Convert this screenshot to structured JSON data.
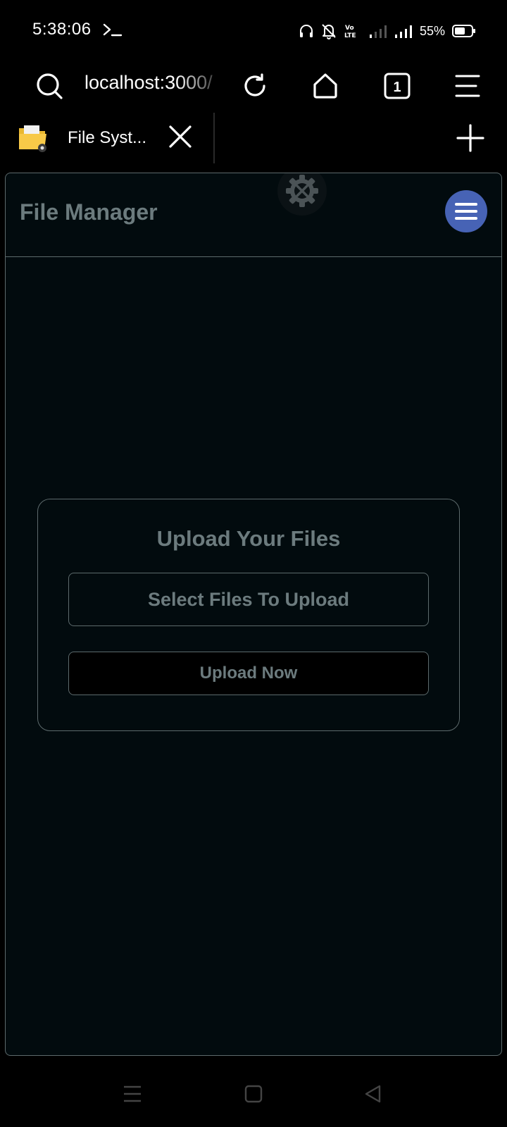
{
  "status_bar": {
    "time": "5:38:06",
    "battery_percent": "55%",
    "icons": [
      "terminal-icon",
      "headphones-icon",
      "bell-off-icon",
      "volte-icon",
      "signal-weak-icon",
      "signal-strong-icon",
      "battery-icon"
    ]
  },
  "browser": {
    "url": "localhost:3000/",
    "tab_count": "1",
    "tab": {
      "title": "File Syst..."
    },
    "icons": [
      "search-icon",
      "reload-icon",
      "home-icon",
      "tabs-icon",
      "menu-icon",
      "close-icon",
      "plus-icon"
    ]
  },
  "page": {
    "app_title": "File Manager",
    "upload_card": {
      "heading": "Upload Your Files",
      "select_label": "Select Files To Upload",
      "upload_label": "Upload Now"
    },
    "colors": {
      "background": "#020b0e",
      "text_muted": "#6c7b7e",
      "border": "#5d6a6c",
      "menu_button": "#4763b5"
    }
  },
  "navigation_bar": {
    "icons": [
      "recent-apps-icon",
      "home-square-icon",
      "back-triangle-icon"
    ]
  }
}
